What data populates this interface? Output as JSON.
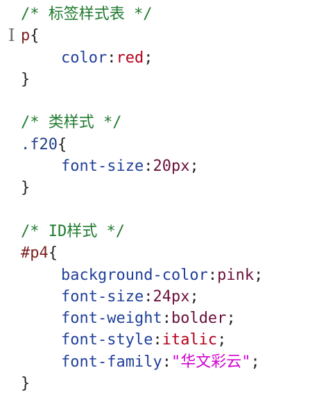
{
  "colors": {
    "comment": "#1e7a2e",
    "property": "#1f3f9a",
    "value": "#b4001c",
    "string": "#d000d0"
  },
  "code": {
    "comment1": "/* 标签样式表 */",
    "rule1": {
      "selector": "p",
      "open": "{",
      "prop1": "color",
      "val1": "red",
      "close": "}"
    },
    "comment2": "/* 类样式 */",
    "rule2": {
      "selector": ".f20",
      "open": "{",
      "prop1": "font-size",
      "val1": "20px",
      "close": "}"
    },
    "comment3": "/* ID样式 */",
    "rule3": {
      "selector": "#p4",
      "open": "{",
      "prop1": "background-color",
      "val1": "pink",
      "prop2": "font-size",
      "val2": "24px",
      "prop3": "font-weight",
      "val3": "bolder",
      "prop4": "font-style",
      "val4": "italic",
      "prop5": "font-family",
      "val5": "\"华文彩云\"",
      "close": "}"
    },
    "colon": ":",
    "semicolon": ";"
  },
  "editor": {
    "cursor_glyph": "I"
  }
}
